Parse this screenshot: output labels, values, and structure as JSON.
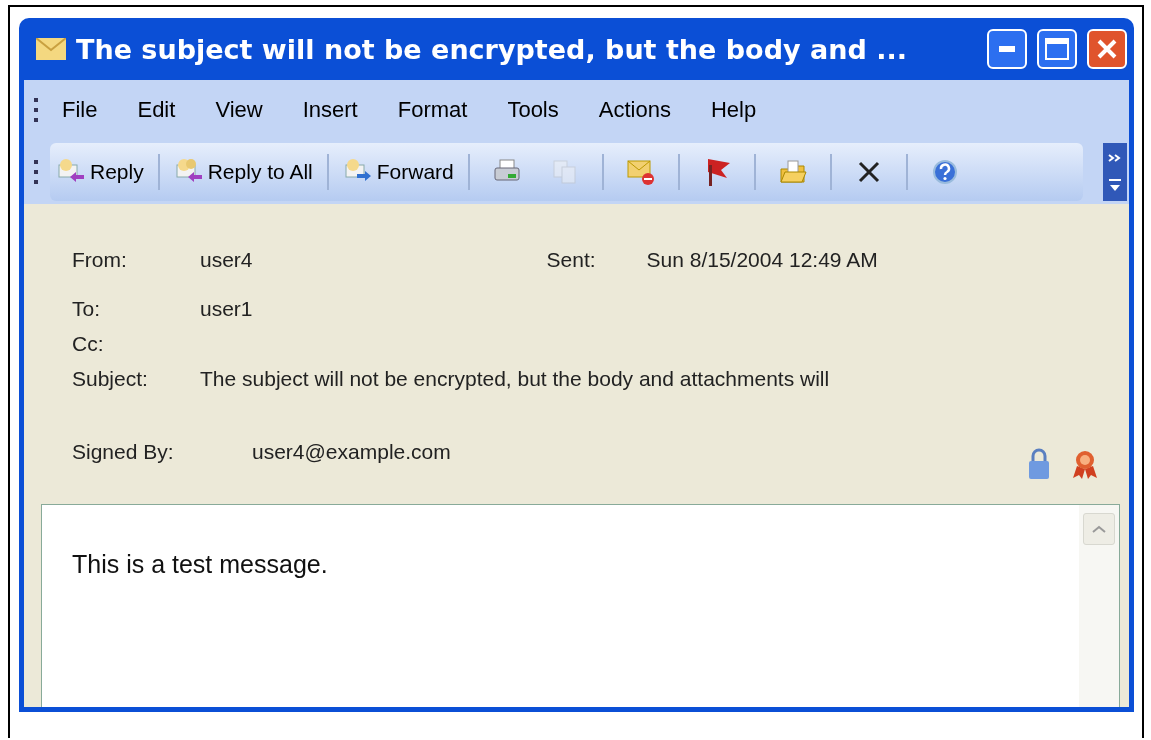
{
  "window": {
    "title": "The subject will not be encrypted, but the body and ..."
  },
  "menu": [
    "File",
    "Edit",
    "View",
    "Insert",
    "Format",
    "Tools",
    "Actions",
    "Help"
  ],
  "toolbar": [
    {
      "kind": "text",
      "label": "Reply",
      "disabled": false
    },
    {
      "kind": "text",
      "label": "Reply to All",
      "disabled": false
    },
    {
      "kind": "text",
      "label": "Forward",
      "disabled": false
    },
    {
      "kind": "icon",
      "disabled": false
    },
    {
      "kind": "icon",
      "disabled": true
    },
    {
      "kind": "icon",
      "disabled": false
    },
    {
      "kind": "icon",
      "disabled": false
    },
    {
      "kind": "icon",
      "disabled": false
    },
    {
      "kind": "icon",
      "disabled": false
    },
    {
      "kind": "icon",
      "disabled": false
    }
  ],
  "header": {
    "from": {
      "label": "From:",
      "value": "user4"
    },
    "sent": {
      "label": "Sent:",
      "value": "Sun 8/15/2004 12:49 AM"
    },
    "to": {
      "label": "To:",
      "value": "user1"
    },
    "cc": {
      "label": "Cc:"
    },
    "subject": {
      "label": "Subject:",
      "value": "The subject will not be encrypted, but the body and attachments will"
    },
    "signed_by": {
      "label": "Signed By:",
      "value": "user4@example.com"
    }
  },
  "body": {
    "text": "This is a test message."
  }
}
